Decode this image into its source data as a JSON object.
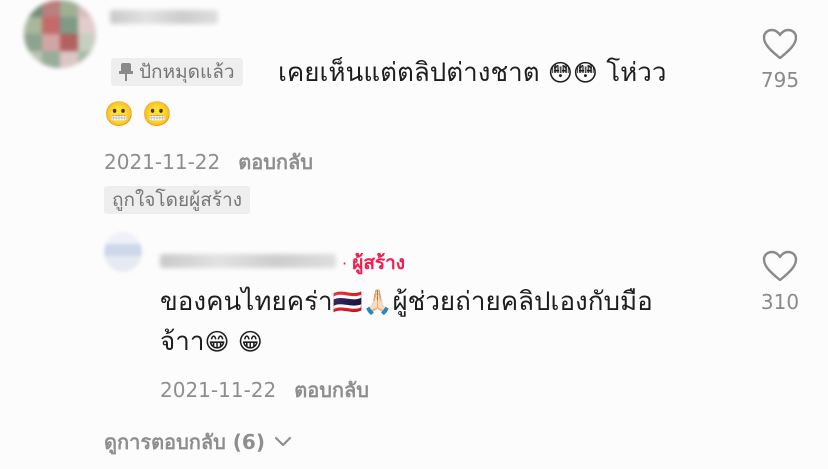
{
  "comment1": {
    "pinned_label": "ปักหมุดแล้ว",
    "text_line1": "เคยเห็นแต่ตลิปต่างชาต",
    "emoji_flushed": "😳",
    "text_after": "โห่วว",
    "emoji_grimace": "😬",
    "date": "2021-11-22",
    "reply_label": "ตอบกลับ",
    "liked_by_creator": "ถูกใจโดยผู้สร้าง",
    "like_count": "795"
  },
  "comment2": {
    "creator_badge": "ผู้สร้าง",
    "text_part1": "ของคนไทยคร่า",
    "emoji_flag": "🇹🇭",
    "emoji_pray": "🙏🏻",
    "text_part2": "ผู้ช่วยถ่ายคลิปเองกับมือ",
    "text_line2": "จ้าา",
    "emoji_grin": "😁",
    "date": "2021-11-22",
    "reply_label": "ตอบกลับ",
    "like_count": "310"
  },
  "view_replies": {
    "label": "ดูการตอบกลับ (6)",
    "chevron": "chevron-down-icon"
  },
  "colors": {
    "creator": "#ee1d52",
    "muted": "#8e8e8e"
  }
}
